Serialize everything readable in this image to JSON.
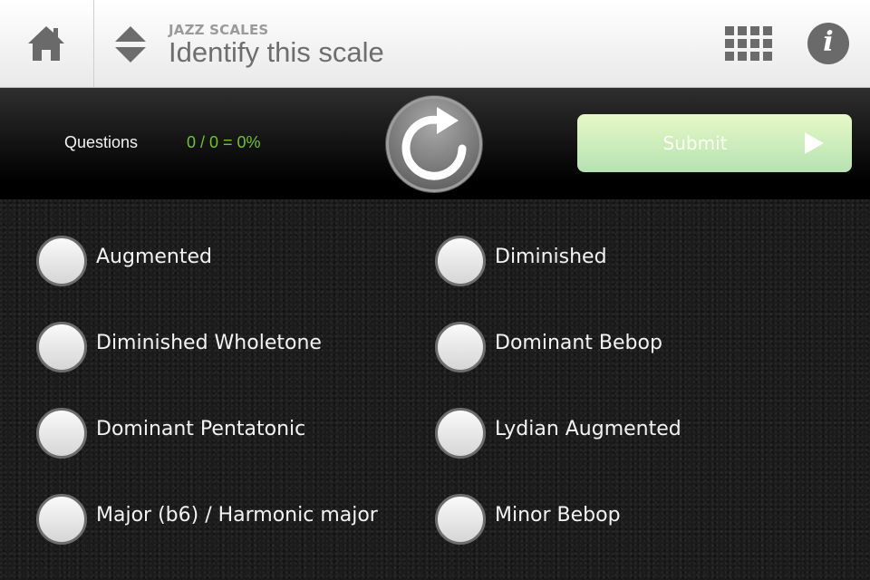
{
  "header": {
    "subtitle": "JAZZ SCALES",
    "title": "Identify this scale",
    "icons": {
      "home": "home-icon",
      "order": "up-down-arrows-icon",
      "grid": "grid-icon",
      "info": "info-icon"
    },
    "info_glyph": "i"
  },
  "status": {
    "questions_label": "Questions",
    "score": "0 / 0 = 0%",
    "score_color": "#71c32a",
    "reload_icon": "reload-icon",
    "submit_label": "Submit"
  },
  "options": [
    {
      "label": "Augmented",
      "selected": false
    },
    {
      "label": "Diminished",
      "selected": false
    },
    {
      "label": "Diminished Wholetone",
      "selected": false
    },
    {
      "label": "Dominant Bebop",
      "selected": false
    },
    {
      "label": "Dominant Pentatonic",
      "selected": false
    },
    {
      "label": "Lydian Augmented",
      "selected": false
    },
    {
      "label": "Major (b6) / Harmonic major",
      "selected": false
    },
    {
      "label": "Minor Bebop",
      "selected": false
    }
  ]
}
